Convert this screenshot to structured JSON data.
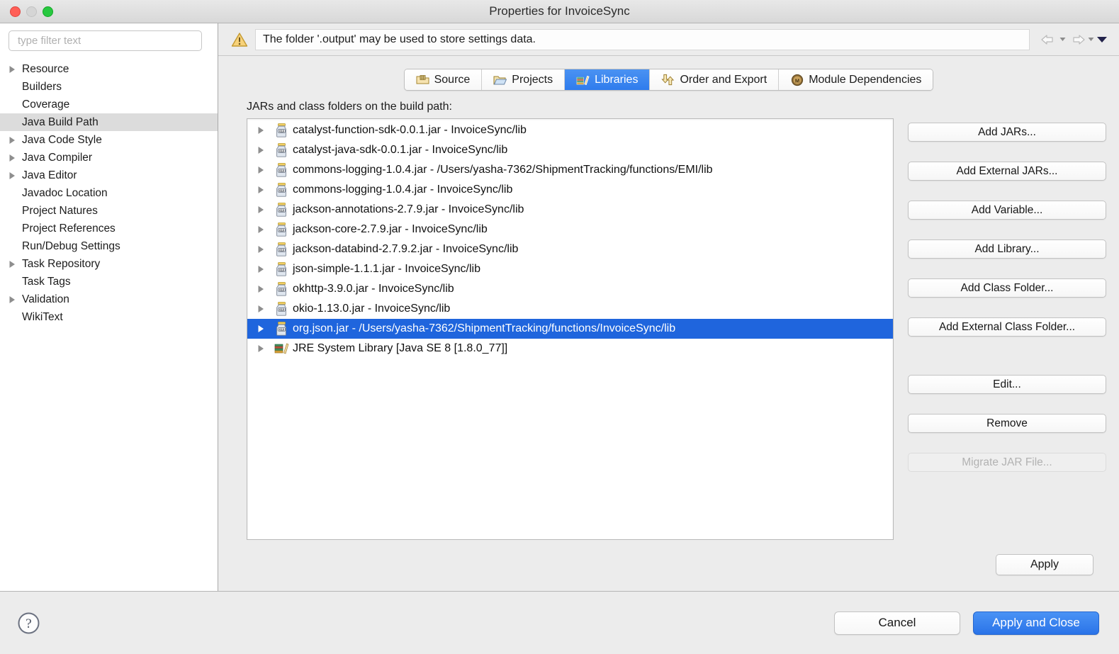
{
  "window": {
    "title": "Properties for InvoiceSync",
    "traffic_lights": [
      "close",
      "minimize",
      "zoom"
    ]
  },
  "sidebar": {
    "filter": {
      "placeholder": "type filter text",
      "value": ""
    },
    "items": [
      {
        "label": "Resource",
        "expandable": true,
        "selected": false
      },
      {
        "label": "Builders",
        "expandable": false,
        "selected": false
      },
      {
        "label": "Coverage",
        "expandable": false,
        "selected": false
      },
      {
        "label": "Java Build Path",
        "expandable": false,
        "selected": true
      },
      {
        "label": "Java Code Style",
        "expandable": true,
        "selected": false
      },
      {
        "label": "Java Compiler",
        "expandable": true,
        "selected": false
      },
      {
        "label": "Java Editor",
        "expandable": true,
        "selected": false
      },
      {
        "label": "Javadoc Location",
        "expandable": false,
        "selected": false
      },
      {
        "label": "Project Natures",
        "expandable": false,
        "selected": false
      },
      {
        "label": "Project References",
        "expandable": false,
        "selected": false
      },
      {
        "label": "Run/Debug Settings",
        "expandable": false,
        "selected": false
      },
      {
        "label": "Task Repository",
        "expandable": true,
        "selected": false
      },
      {
        "label": "Task Tags",
        "expandable": false,
        "selected": false
      },
      {
        "label": "Validation",
        "expandable": true,
        "selected": false
      },
      {
        "label": "WikiText",
        "expandable": false,
        "selected": false
      }
    ]
  },
  "warning": {
    "icon": "warning-triangle-icon",
    "message": "The folder '.output' may be used to store settings data."
  },
  "navigation": {
    "back": "back-arrow",
    "forward": "forward-arrow",
    "menu": "dropdown-chevron"
  },
  "tabs": [
    {
      "label": "Source",
      "icon": "source-folder-icon",
      "active": false
    },
    {
      "label": "Projects",
      "icon": "projects-folder-icon",
      "active": false
    },
    {
      "label": "Libraries",
      "icon": "libraries-books-icon",
      "active": true
    },
    {
      "label": "Order and Export",
      "icon": "order-export-arrows-icon",
      "active": false
    },
    {
      "label": "Module Dependencies",
      "icon": "module-badge-icon",
      "active": false
    }
  ],
  "main": {
    "list_label": "JARs and class folders on the build path:",
    "entries": [
      {
        "text": "catalyst-function-sdk-0.0.1.jar - InvoiceSync/lib",
        "icon": "jar-icon",
        "selected": false
      },
      {
        "text": "catalyst-java-sdk-0.0.1.jar - InvoiceSync/lib",
        "icon": "jar-icon",
        "selected": false
      },
      {
        "text": "commons-logging-1.0.4.jar - /Users/yasha-7362/ShipmentTracking/functions/EMI/lib",
        "icon": "jar-icon",
        "selected": false
      },
      {
        "text": "commons-logging-1.0.4.jar - InvoiceSync/lib",
        "icon": "jar-icon",
        "selected": false
      },
      {
        "text": "jackson-annotations-2.7.9.jar - InvoiceSync/lib",
        "icon": "jar-icon",
        "selected": false
      },
      {
        "text": "jackson-core-2.7.9.jar - InvoiceSync/lib",
        "icon": "jar-icon",
        "selected": false
      },
      {
        "text": "jackson-databind-2.7.9.2.jar - InvoiceSync/lib",
        "icon": "jar-icon",
        "selected": false
      },
      {
        "text": "json-simple-1.1.1.jar - InvoiceSync/lib",
        "icon": "jar-icon",
        "selected": false
      },
      {
        "text": "okhttp-3.9.0.jar - InvoiceSync/lib",
        "icon": "jar-icon",
        "selected": false
      },
      {
        "text": "okio-1.13.0.jar - InvoiceSync/lib",
        "icon": "jar-icon",
        "selected": false
      },
      {
        "text": "org.json.jar - /Users/yasha-7362/ShipmentTracking/functions/InvoiceSync/lib",
        "icon": "jar-icon",
        "selected": true
      },
      {
        "text": "JRE System Library [Java SE 8 [1.8.0_77]]",
        "icon": "library-books-icon",
        "selected": false
      }
    ],
    "buttons": [
      {
        "label": "Add JARs...",
        "enabled": true
      },
      {
        "label": "Add External JARs...",
        "enabled": true
      },
      {
        "label": "Add Variable...",
        "enabled": true
      },
      {
        "label": "Add Library...",
        "enabled": true
      },
      {
        "label": "Add Class Folder...",
        "enabled": true
      },
      {
        "label": "Add External Class Folder...",
        "enabled": true
      },
      {
        "label": "Edit...",
        "enabled": true
      },
      {
        "label": "Remove",
        "enabled": true
      },
      {
        "label": "Migrate JAR File...",
        "enabled": false
      }
    ],
    "apply_label": "Apply"
  },
  "footer": {
    "help_icon": "help-question-icon",
    "cancel_label": "Cancel",
    "primary_label": "Apply and Close"
  },
  "colors": {
    "selection_blue": "#1f65dd",
    "active_tab_blue": "#2f7ced",
    "primary_button_blue": "#2a73e8",
    "warning_gold": "#e8b43c",
    "window_bg": "#ececec"
  }
}
